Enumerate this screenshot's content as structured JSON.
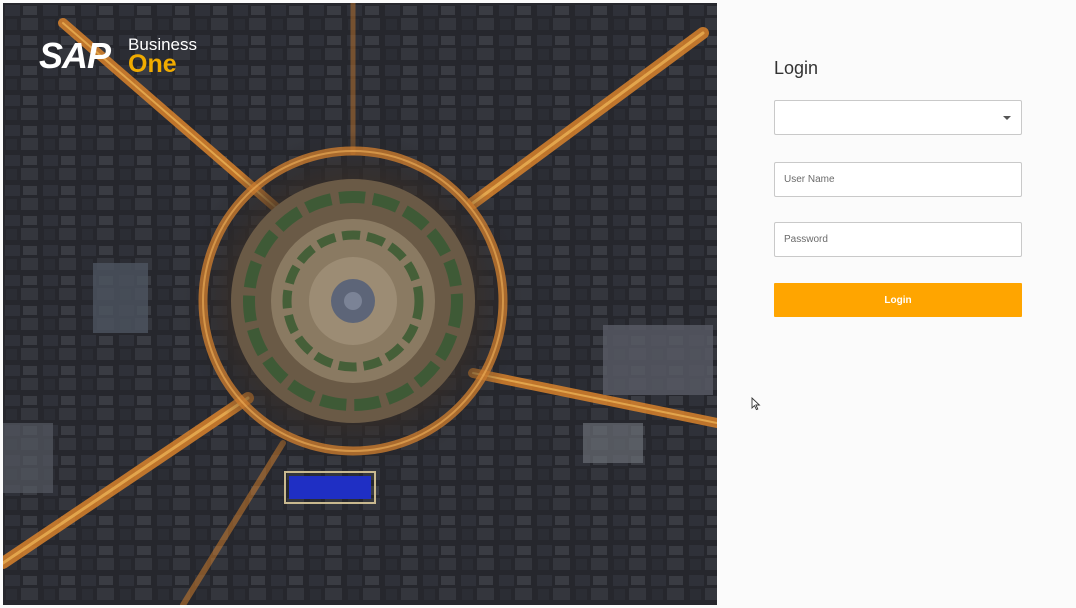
{
  "brand": {
    "logo_text": "SAP",
    "product_line1": "Business",
    "product_line2": "One"
  },
  "login": {
    "title": "Login",
    "company_select": {
      "value": ""
    },
    "username": {
      "placeholder": "User Name",
      "value": ""
    },
    "password": {
      "placeholder": "Password",
      "value": ""
    },
    "button_label": "Login"
  },
  "colors": {
    "accent": "#ffa500",
    "brand_one": "#f0ab00",
    "panel_bg": "#fbfbfb",
    "field_border": "#c9c9c9"
  },
  "icons": {
    "select_caret": "chevron-down-icon",
    "mouse": "cursor-icon"
  }
}
